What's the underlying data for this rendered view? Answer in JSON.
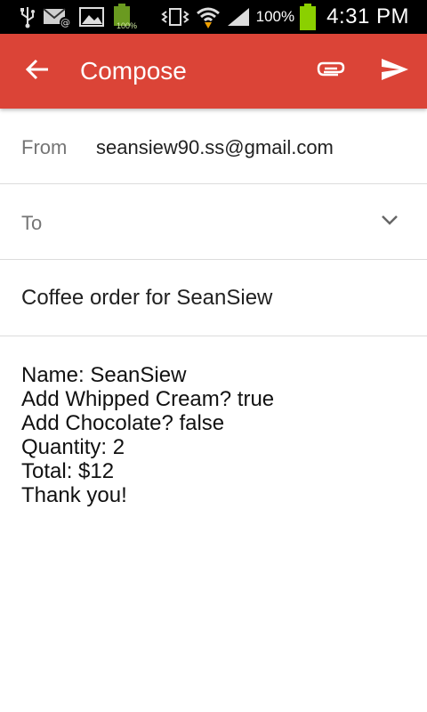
{
  "status_bar": {
    "battery_small_label": "100%",
    "battery_percent": "100%",
    "time": "4:31 PM",
    "icons": [
      "usb-icon",
      "email-notification-icon",
      "gallery-icon",
      "battery-small-icon",
      "vibrate-icon",
      "wifi-icon",
      "signal-icon",
      "battery-icon"
    ]
  },
  "app_bar": {
    "title": "Compose",
    "color": "#db4437",
    "back_icon": "arrow-back-icon",
    "attach_icon": "paperclip-icon",
    "send_icon": "send-icon"
  },
  "form": {
    "from_label": "From",
    "from_value": "seansiew90.ss@gmail.com",
    "to_label": "To",
    "to_value": "",
    "subject": "Coffee order for SeanSiew"
  },
  "body": {
    "lines": [
      "Name: SeanSiew",
      "Add Whipped Cream? true",
      "Add Chocolate? false",
      "Quantity: 2",
      "Total: $12",
      "Thank you!"
    ]
  }
}
